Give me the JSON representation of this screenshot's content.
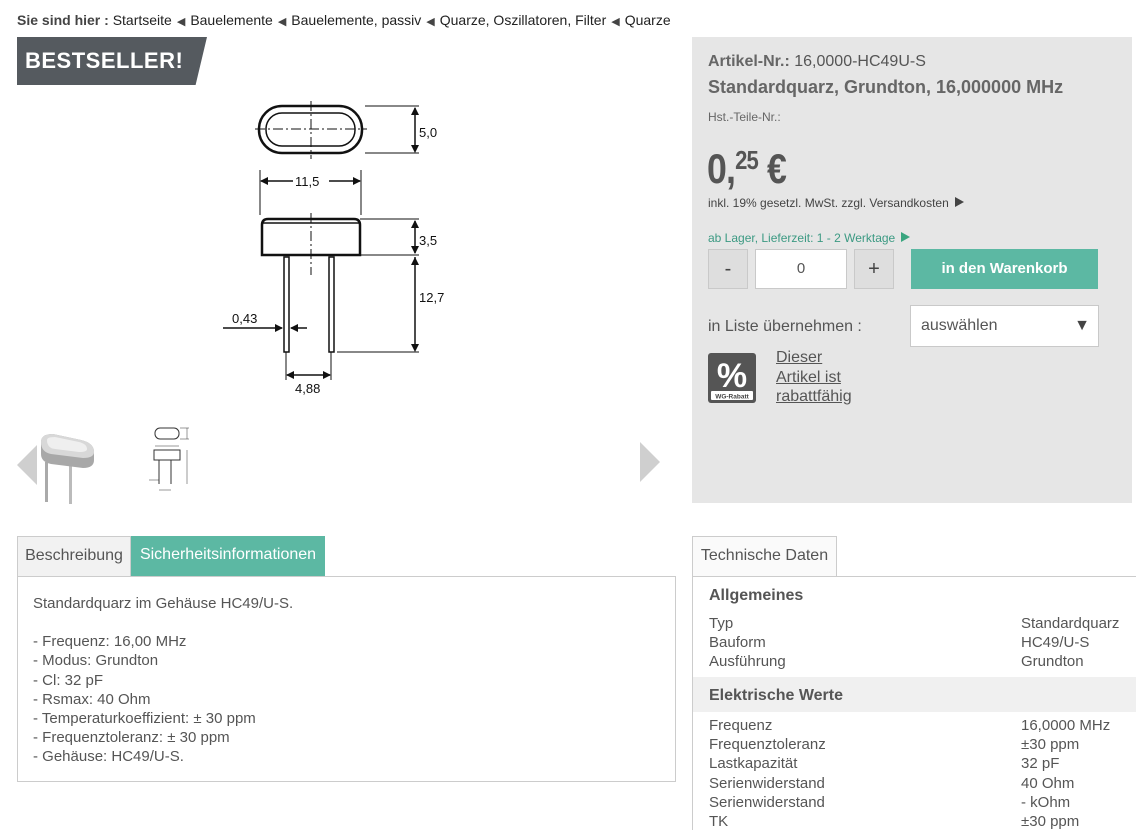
{
  "breadcrumb": {
    "label": "Sie sind hier :",
    "items": [
      "Startseite",
      "Bauelemente",
      "Bauelemente, passiv",
      "Quarze, Oszillatoren, Filter",
      "Quarze"
    ]
  },
  "badge": "BESTSELLER!",
  "drawing": {
    "dim_height": "5,0",
    "dim_width": "11,5",
    "dim_body": "3,5",
    "dim_leads": "12,7",
    "dim_lead_dia": "0,43",
    "dim_pitch": "4,88"
  },
  "product": {
    "art_label": "Artikel-Nr.:",
    "art_number": "16,0000-HC49U-S",
    "title": "Standardquarz, Grundton, 16,000000 MHz",
    "hst_label": "Hst.-Teile-Nr.:",
    "price_main": "0,",
    "price_cents": "25",
    "price_currency": "€",
    "tax_note": "inkl. 19% gesetzl. MwSt. zzgl. Versandkosten",
    "stock": "ab Lager, Lieferzeit: 1 - 2 Werktage",
    "qty_minus": "-",
    "qty_value": "0",
    "qty_plus": "+",
    "cart_button": "in den Warenkorb",
    "list_label": "in Liste übernehmen :",
    "list_select": "auswählen",
    "rabatt_icon_text": "WG-Rabatt",
    "rabatt_link": "Dieser Artikel ist rabattfähig"
  },
  "tabs": {
    "desc": "Beschreibung",
    "safety": "Sicherheitsinformationen"
  },
  "description": {
    "intro": "Standardquarz im Gehäuse HC49/U-S.",
    "items": [
      "- Frequenz: 16,00 MHz",
      "- Modus: Grundton",
      "- Cl: 32 pF",
      "- Rsmax: 40 Ohm",
      "- Temperaturkoeffizient: ± 30 ppm",
      "- Frequenztoleranz: ± 30 ppm",
      "- Gehäuse: HC49/U-S."
    ]
  },
  "tech": {
    "tab": "Technische Daten",
    "group1": {
      "title": "Allgemeines",
      "rows": [
        {
          "k": "Typ",
          "v": "Standardquarz"
        },
        {
          "k": "Bauform",
          "v": "HC49/U-S"
        },
        {
          "k": "Ausführung",
          "v": "Grundton"
        }
      ]
    },
    "group2": {
      "title": "Elektrische Werte",
      "rows": [
        {
          "k": "Frequenz",
          "v": "16,0000 MHz"
        },
        {
          "k": "Frequenztoleranz",
          "v": "±30 ppm"
        },
        {
          "k": "Lastkapazität",
          "v": "32 pF"
        },
        {
          "k": "Serienwiderstand",
          "v": "40 Ohm"
        },
        {
          "k": "Serienwiderstand",
          "v": "- kOhm"
        },
        {
          "k": "TK",
          "v": "±30 ppm"
        }
      ]
    }
  }
}
